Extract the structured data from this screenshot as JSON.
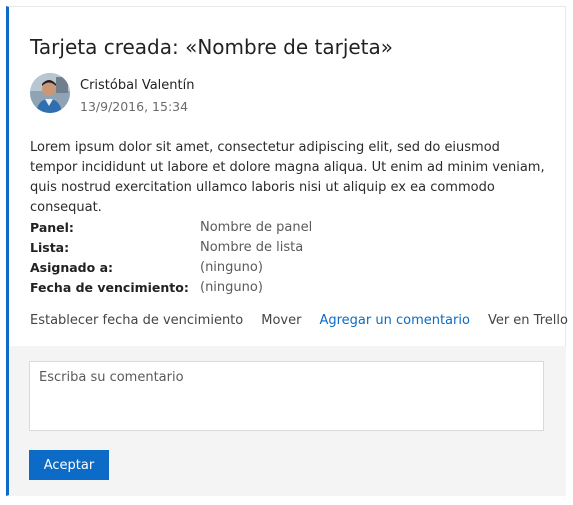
{
  "card": {
    "title": "Tarjeta creada: «Nombre de tarjeta»",
    "author": "Cristóbal Valentín",
    "timestamp": "13/9/2016, 15:34",
    "body": "Lorem ipsum dolor sit amet, consectetur adipiscing elit, sed do eiusmod tempor incididunt ut labore et dolore magna aliqua. Ut enim ad minim veniam, quis nostrud exercitation ullamco laboris nisi ut aliquip ex ea commodo consequat.",
    "fields": [
      {
        "label": "Panel:",
        "value": "Nombre de panel"
      },
      {
        "label": "Lista:",
        "value": "Nombre de lista"
      },
      {
        "label": "Asignado a:",
        "value": "(ninguno)"
      },
      {
        "label": "Fecha de vencimiento:",
        "value": "(ninguno)"
      }
    ],
    "actions": {
      "set_due_date": "Establecer fecha de vencimiento",
      "move": "Mover",
      "add_comment": "Agregar un comentario",
      "view_in_trello": "Ver en Trello"
    }
  },
  "comment": {
    "placeholder": "Escriba su comentario",
    "submit_label": "Aceptar"
  },
  "colors": {
    "accent": "#0b6bc6",
    "panel_background": "#f4f4f4"
  },
  "icons": {
    "avatar": "user-avatar-photo"
  }
}
